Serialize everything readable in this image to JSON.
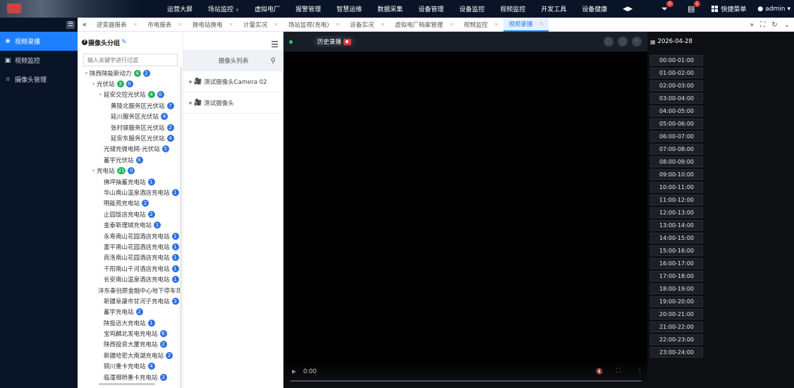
{
  "top_nav": {
    "items": [
      {
        "label": "运营大屏",
        "dropdown": false
      },
      {
        "label": "场站监控",
        "dropdown": true
      },
      {
        "label": "虚拟电厂",
        "dropdown": false
      },
      {
        "label": "报警管理",
        "dropdown": false
      },
      {
        "label": "智慧运维",
        "dropdown": false
      },
      {
        "label": "数据采集",
        "dropdown": false
      },
      {
        "label": "设备管理",
        "dropdown": false
      },
      {
        "label": "设备监控",
        "dropdown": false
      },
      {
        "label": "视频监控",
        "dropdown": false
      },
      {
        "label": "开发工具",
        "dropdown": false
      },
      {
        "label": "设备健康",
        "dropdown": false
      }
    ],
    "bell_badge": "0",
    "doc_badge": "1",
    "quick_menu": "快捷菜单",
    "user": "admin"
  },
  "sidebar": {
    "items": [
      {
        "label": "视频录播",
        "active": true
      },
      {
        "label": "视频监控",
        "active": false
      },
      {
        "label": "摄像头管理",
        "active": false
      }
    ]
  },
  "tabs": [
    {
      "label": "逆变器报表",
      "active": false
    },
    {
      "label": "市电报表",
      "active": false
    },
    {
      "label": "换电站换电",
      "active": false
    },
    {
      "label": "计量实况",
      "active": false
    },
    {
      "label": "场站监视(充电)",
      "active": false
    },
    {
      "label": "设备实况",
      "active": false
    },
    {
      "label": "虚拟电厂档案管理",
      "active": false
    },
    {
      "label": "视频监控",
      "active": false
    },
    {
      "label": "视频录播",
      "active": true
    }
  ],
  "group_panel": {
    "title": "摄像头分组",
    "filter_placeholder": "输入关键字进行过滤",
    "tree": [
      {
        "label": "陕西陕能新动力",
        "level": 0,
        "caret": true,
        "g": "4",
        "b": "2"
      },
      {
        "label": "光伏站",
        "level": 1,
        "caret": true,
        "g": "3",
        "b": "0"
      },
      {
        "label": "延安交控光伏站",
        "level": 2,
        "caret": true,
        "g": "4",
        "b": "0"
      },
      {
        "label": "黄陵北服务区光伏站",
        "level": 3,
        "caret": false,
        "g": "",
        "b": "7"
      },
      {
        "label": "延川服务区光伏站",
        "level": 3,
        "caret": false,
        "g": "",
        "b": "4"
      },
      {
        "label": "张村驿服务区光伏站",
        "level": 3,
        "caret": false,
        "g": "",
        "b": "2"
      },
      {
        "label": "延安东服务区光伏站",
        "level": 3,
        "caret": false,
        "g": "",
        "b": "4"
      },
      {
        "label": "光储充微电网-光伏站",
        "level": 2,
        "caret": false,
        "g": "",
        "b": "5"
      },
      {
        "label": "蓄宇光伏站",
        "level": 2,
        "caret": false,
        "g": "",
        "b": "6"
      },
      {
        "label": "充电站",
        "level": 1,
        "caret": true,
        "g": "21",
        "b": "0"
      },
      {
        "label": "佛坪抽蓄充电站",
        "level": 2,
        "caret": false,
        "g": "",
        "b": "1"
      },
      {
        "label": "华山南山温泉酒店充电站",
        "level": 2,
        "caret": false,
        "g": "",
        "b": "1"
      },
      {
        "label": "明能苑充电站",
        "level": 2,
        "caret": false,
        "g": "",
        "b": "2"
      },
      {
        "label": "止园饭店充电站",
        "level": 2,
        "caret": false,
        "g": "",
        "b": "2"
      },
      {
        "label": "金泰新理城充电站",
        "level": 2,
        "caret": false,
        "g": "",
        "b": "1"
      },
      {
        "label": "永寿南山花园酒店充电站",
        "level": 2,
        "caret": false,
        "g": "",
        "b": "1"
      },
      {
        "label": "富平南山花园酒店充电站",
        "level": 2,
        "caret": false,
        "g": "",
        "b": "1"
      },
      {
        "label": "商洛南山花园酒店充电站",
        "level": 2,
        "caret": false,
        "g": "",
        "b": "1"
      },
      {
        "label": "千阳南山千河酒店充电站",
        "level": 2,
        "caret": false,
        "g": "",
        "b": "1"
      },
      {
        "label": "长安南山温泉酒店充电站",
        "level": 2,
        "caret": false,
        "g": "",
        "b": "1"
      },
      {
        "label": "沣东秦创原金融中心地下停车场",
        "level": 2,
        "caret": false,
        "g": "",
        "b": ""
      },
      {
        "label": "新疆阜康市甘河子充电站",
        "level": 2,
        "caret": false,
        "g": "",
        "b": "3"
      },
      {
        "label": "蓄宇充电站",
        "level": 2,
        "caret": false,
        "g": "",
        "b": "2"
      },
      {
        "label": "陕投远大充电站",
        "level": 2,
        "caret": false,
        "g": "",
        "b": "1"
      },
      {
        "label": "宝鸡麟北发电充电站",
        "level": 2,
        "caret": false,
        "g": "",
        "b": "6"
      },
      {
        "label": "陕西投资大厦充电站",
        "level": 2,
        "caret": false,
        "g": "",
        "b": "2"
      },
      {
        "label": "新疆哈密大南湖充电站",
        "level": 2,
        "caret": false,
        "g": "",
        "b": "2"
      },
      {
        "label": "铜川重卡充电站",
        "level": 2,
        "caret": false,
        "g": "",
        "b": "4"
      },
      {
        "label": "临潼相桥重卡充电站",
        "level": 2,
        "caret": false,
        "g": "",
        "b": "3"
      }
    ]
  },
  "camera_panel": {
    "list_title": "摄像头列表",
    "cameras": [
      {
        "label": "测试摄像头Camera 02"
      },
      {
        "label": "测试摄像头"
      }
    ]
  },
  "video": {
    "history_label": "历史录播",
    "current_time": "0:00"
  },
  "time_panel": {
    "date": "2026-04-28",
    "slots": [
      "00:00-01:00",
      "01:00-02:00",
      "02:00-03:00",
      "03:00-04:00",
      "04:00-05:00",
      "05:00-06:00",
      "06:00-07:00",
      "07:00-08:00",
      "08:00-09:00",
      "09:00-10:00",
      "10:00-11:00",
      "11:00-12:00",
      "12:00-13:00",
      "13:00-14:00",
      "14:00-15:00",
      "15:00-16:00",
      "16:00-17:00",
      "17:00-18:00",
      "18:00-19:00",
      "19:00-20:00",
      "20:00-21:00",
      "21:00-22:00",
      "22:00-23:00",
      "23:00-24:00"
    ]
  },
  "colors": {
    "accent": "#1e7fff",
    "nav_bg": "#0a1428",
    "badge_green": "#21b25b",
    "badge_blue": "#2f6fe0",
    "record_red": "#e53935"
  }
}
